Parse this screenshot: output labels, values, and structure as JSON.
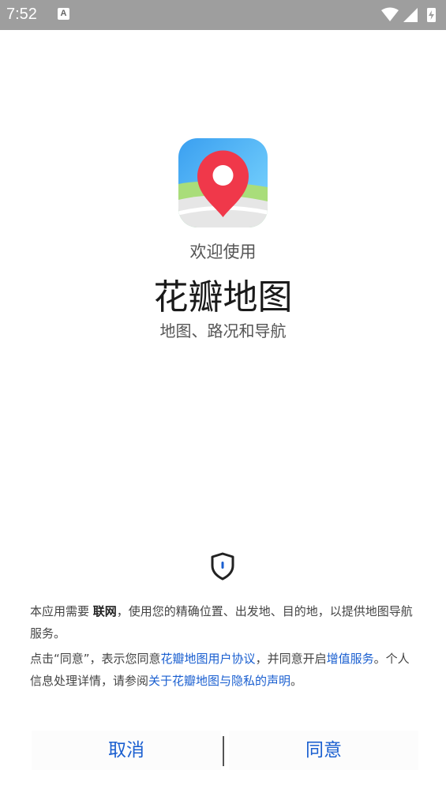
{
  "status_bar": {
    "time": "7:52",
    "notification_letter": "A"
  },
  "welcome": {
    "greeting": "欢迎使用",
    "app_name": "花瓣地图",
    "tagline": "地图、路况和导航"
  },
  "notice": {
    "p1_prefix": "本应用需要 ",
    "p1_bold": "联网",
    "p1_suffix": "，使用您的精确位置、出发地、目的地，以提供地图导航服务。",
    "p2_part1": "点击“同意”，表示您同意",
    "p2_link1": "花瓣地图用户协议",
    "p2_part2": "，并同意开启",
    "p2_link2": "增值服务",
    "p2_part3": "。个人信息处理详情，请参阅",
    "p2_link3": "关于花瓣地图与隐私的声明",
    "p2_part4": "。"
  },
  "buttons": {
    "cancel": "取消",
    "agree": "同意"
  },
  "colors": {
    "link": "#1a5fd0",
    "status_bar": "#9e9e9e",
    "pin_red": "#f0384a"
  }
}
